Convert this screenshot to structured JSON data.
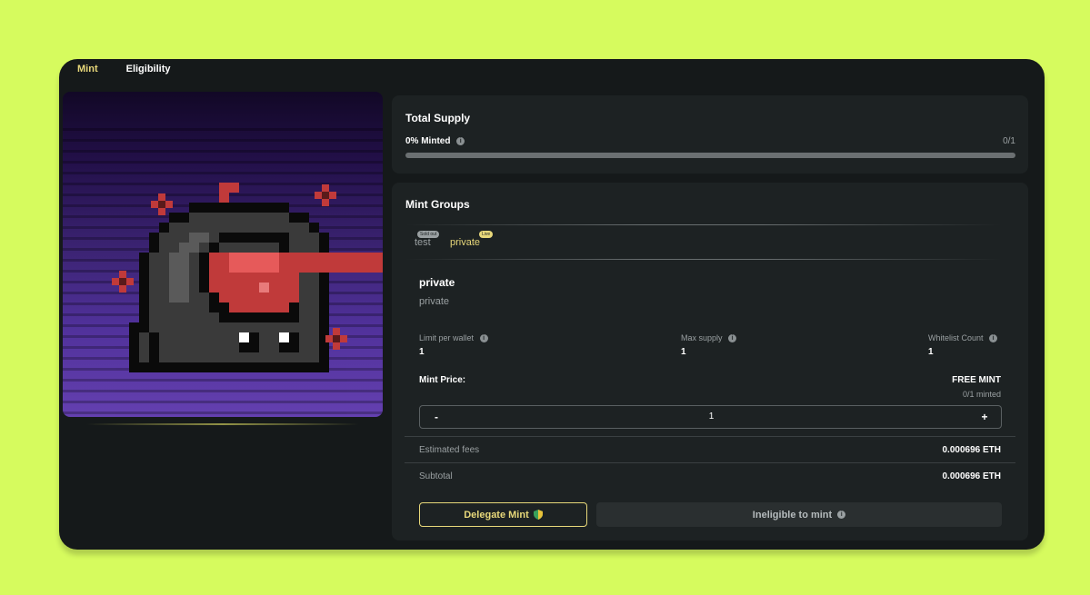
{
  "tabs": [
    {
      "label": "Mint",
      "active": true
    },
    {
      "label": "Eligibility",
      "active": false
    }
  ],
  "colors": {
    "page_background": "#d6fb5e",
    "window_background": "#15191a",
    "panel_background": "#1d2223",
    "accent": "#e8d87a",
    "muted_text": "#9aa0a2"
  },
  "artwork": {
    "icon": "pixel-art-hooded-character"
  },
  "total_supply": {
    "title": "Total Supply",
    "minted_label": "0% Minted",
    "count": "0/1",
    "progress_fraction": 0
  },
  "mint_groups": {
    "title": "Mint Groups",
    "tabs": [
      {
        "label": "test",
        "badge": "Sold out",
        "active": false
      },
      {
        "label": "private",
        "badge": "Live",
        "active": true
      }
    ],
    "selected": {
      "name": "private",
      "subtitle": "private",
      "stats": [
        {
          "label": "Limit per wallet",
          "value": "1"
        },
        {
          "label": "Max supply",
          "value": "1"
        },
        {
          "label": "Whitelist Count",
          "value": "1"
        }
      ],
      "mint_price_label": "Mint Price:",
      "mint_price_value": "FREE MINT",
      "minted_text": "0/1 minted",
      "quantity": {
        "minus": "-",
        "value": "1",
        "plus": "+"
      },
      "estimated_fees_label": "Estimated fees",
      "estimated_fees_value": "0.000696 ETH",
      "subtotal_label": "Subtotal",
      "subtotal_value": "0.000696 ETH",
      "delegate_button": "Delegate Mint",
      "ineligible_button": "Ineligible to mint"
    }
  }
}
